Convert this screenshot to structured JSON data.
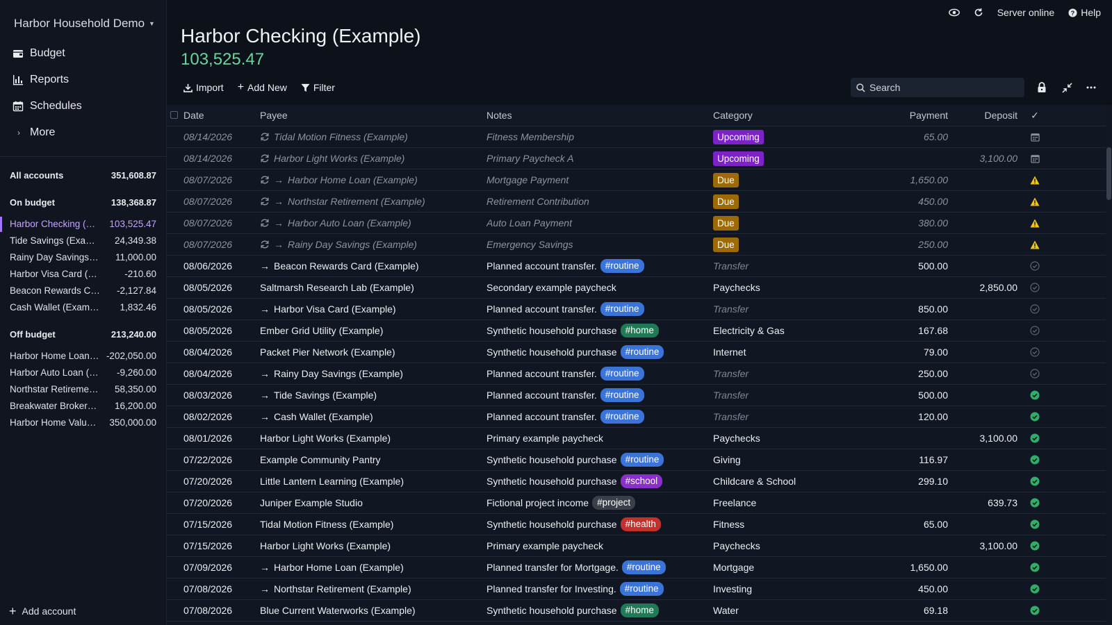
{
  "sidebar": {
    "budget_name": "Harbor Household Demo",
    "nav": {
      "budget": "Budget",
      "reports": "Reports",
      "schedules": "Schedules",
      "more": "More"
    },
    "all_accounts": {
      "label": "All accounts",
      "balance": "351,608.87"
    },
    "on_budget": {
      "label": "On budget",
      "balance": "138,368.87"
    },
    "on_budget_accounts": [
      {
        "name": "Harbor Checking (Example)",
        "balance": "103,525.47"
      },
      {
        "name": "Tide Savings (Example)",
        "balance": "24,349.38"
      },
      {
        "name": "Rainy Day Savings (Example)",
        "balance": "11,000.00"
      },
      {
        "name": "Harbor Visa Card (Example)",
        "balance": "-210.60"
      },
      {
        "name": "Beacon Rewards Card (Example)",
        "balance": "-2,127.84"
      },
      {
        "name": "Cash Wallet (Example)",
        "balance": "1,832.46"
      }
    ],
    "off_budget": {
      "label": "Off budget",
      "balance": "213,240.00"
    },
    "off_budget_accounts": [
      {
        "name": "Harbor Home Loan (Example)",
        "balance": "-202,050.00"
      },
      {
        "name": "Harbor Auto Loan (Example)",
        "balance": "-9,260.00"
      },
      {
        "name": "Northstar Retirement (Example)",
        "balance": "58,350.00"
      },
      {
        "name": "Breakwater Brokerage (Example)",
        "balance": "16,200.00"
      },
      {
        "name": "Harbor Home Value (Example)",
        "balance": "350,000.00"
      }
    ],
    "add_account": "Add account"
  },
  "topbar": {
    "server_status": "Server online",
    "help": "Help"
  },
  "account": {
    "title": "Harbor Checking (Example)",
    "balance": "103,525.47"
  },
  "toolbar": {
    "import": "Import",
    "add_new": "Add New",
    "filter": "Filter",
    "search_placeholder": "Search"
  },
  "table": {
    "headers": {
      "date": "Date",
      "payee": "Payee",
      "notes": "Notes",
      "category": "Category",
      "payment": "Payment",
      "deposit": "Deposit",
      "cleared": "✓"
    },
    "rows": [
      {
        "date": "08/14/2026",
        "payee": "Tidal Motion Fitness (Example)",
        "recurring": true,
        "transfer": false,
        "notes": "Fitness Membership",
        "tag": "",
        "category": "Upcoming",
        "cat_type": "upcoming",
        "payment": "65.00",
        "deposit": "",
        "status": "calendar",
        "scheduled": true
      },
      {
        "date": "08/14/2026",
        "payee": "Harbor Light Works (Example)",
        "recurring": true,
        "transfer": false,
        "notes": "Primary Paycheck A",
        "tag": "",
        "category": "Upcoming",
        "cat_type": "upcoming",
        "payment": "",
        "deposit": "3,100.00",
        "status": "calendar",
        "scheduled": true
      },
      {
        "date": "08/07/2026",
        "payee": "Harbor Home Loan (Example)",
        "recurring": true,
        "transfer": true,
        "notes": "Mortgage Payment",
        "tag": "",
        "category": "Due",
        "cat_type": "due",
        "payment": "1,650.00",
        "deposit": "",
        "status": "warning",
        "scheduled": true
      },
      {
        "date": "08/07/2026",
        "payee": "Northstar Retirement (Example)",
        "recurring": true,
        "transfer": true,
        "notes": "Retirement Contribution",
        "tag": "",
        "category": "Due",
        "cat_type": "due",
        "payment": "450.00",
        "deposit": "",
        "status": "warning",
        "scheduled": true
      },
      {
        "date": "08/07/2026",
        "payee": "Harbor Auto Loan (Example)",
        "recurring": true,
        "transfer": true,
        "notes": "Auto Loan Payment",
        "tag": "",
        "category": "Due",
        "cat_type": "due",
        "payment": "380.00",
        "deposit": "",
        "status": "warning",
        "scheduled": true
      },
      {
        "date": "08/07/2026",
        "payee": "Rainy Day Savings (Example)",
        "recurring": true,
        "transfer": true,
        "notes": "Emergency Savings",
        "tag": "",
        "category": "Due",
        "cat_type": "due",
        "payment": "250.00",
        "deposit": "",
        "status": "warning",
        "scheduled": true
      },
      {
        "date": "08/06/2026",
        "payee": "Beacon Rewards Card (Example)",
        "recurring": false,
        "transfer": true,
        "notes": "Planned account transfer.",
        "tag": "#routine",
        "category": "Transfer",
        "cat_type": "transfer",
        "payment": "500.00",
        "deposit": "",
        "status": "uncleared",
        "scheduled": false
      },
      {
        "date": "08/05/2026",
        "payee": "Saltmarsh Research Lab (Example)",
        "recurring": false,
        "transfer": false,
        "notes": "Secondary example paycheck",
        "tag": "",
        "category": "Paychecks",
        "cat_type": "normal",
        "payment": "",
        "deposit": "2,850.00",
        "status": "uncleared",
        "scheduled": false
      },
      {
        "date": "08/05/2026",
        "payee": "Harbor Visa Card (Example)",
        "recurring": false,
        "transfer": true,
        "notes": "Planned account transfer.",
        "tag": "#routine",
        "category": "Transfer",
        "cat_type": "transfer",
        "payment": "850.00",
        "deposit": "",
        "status": "uncleared",
        "scheduled": false
      },
      {
        "date": "08/05/2026",
        "payee": "Ember Grid Utility (Example)",
        "recurring": false,
        "transfer": false,
        "notes": "Synthetic household purchase",
        "tag": "#home",
        "category": "Electricity & Gas",
        "cat_type": "normal",
        "payment": "167.68",
        "deposit": "",
        "status": "uncleared",
        "scheduled": false
      },
      {
        "date": "08/04/2026",
        "payee": "Packet Pier Network (Example)",
        "recurring": false,
        "transfer": false,
        "notes": "Synthetic household purchase",
        "tag": "#routine",
        "category": "Internet",
        "cat_type": "normal",
        "payment": "79.00",
        "deposit": "",
        "status": "uncleared",
        "scheduled": false
      },
      {
        "date": "08/04/2026",
        "payee": "Rainy Day Savings (Example)",
        "recurring": false,
        "transfer": true,
        "notes": "Planned account transfer.",
        "tag": "#routine",
        "category": "Transfer",
        "cat_type": "transfer",
        "payment": "250.00",
        "deposit": "",
        "status": "uncleared",
        "scheduled": false
      },
      {
        "date": "08/03/2026",
        "payee": "Tide Savings (Example)",
        "recurring": false,
        "transfer": true,
        "notes": "Planned account transfer.",
        "tag": "#routine",
        "category": "Transfer",
        "cat_type": "transfer",
        "payment": "500.00",
        "deposit": "",
        "status": "cleared",
        "scheduled": false
      },
      {
        "date": "08/02/2026",
        "payee": "Cash Wallet (Example)",
        "recurring": false,
        "transfer": true,
        "notes": "Planned account transfer.",
        "tag": "#routine",
        "category": "Transfer",
        "cat_type": "transfer",
        "payment": "120.00",
        "deposit": "",
        "status": "cleared",
        "scheduled": false
      },
      {
        "date": "08/01/2026",
        "payee": "Harbor Light Works (Example)",
        "recurring": false,
        "transfer": false,
        "notes": "Primary example paycheck",
        "tag": "",
        "category": "Paychecks",
        "cat_type": "normal",
        "payment": "",
        "deposit": "3,100.00",
        "status": "cleared",
        "scheduled": false
      },
      {
        "date": "07/22/2026",
        "payee": "Example Community Pantry",
        "recurring": false,
        "transfer": false,
        "notes": "Synthetic household purchase",
        "tag": "#routine",
        "category": "Giving",
        "cat_type": "normal",
        "payment": "116.97",
        "deposit": "",
        "status": "cleared",
        "scheduled": false
      },
      {
        "date": "07/20/2026",
        "payee": "Little Lantern Learning (Example)",
        "recurring": false,
        "transfer": false,
        "notes": "Synthetic household purchase",
        "tag": "#school",
        "category": "Childcare & School",
        "cat_type": "normal",
        "payment": "299.10",
        "deposit": "",
        "status": "cleared",
        "scheduled": false
      },
      {
        "date": "07/20/2026",
        "payee": "Juniper Example Studio",
        "recurring": false,
        "transfer": false,
        "notes": "Fictional project income",
        "tag": "#project",
        "category": "Freelance",
        "cat_type": "normal",
        "payment": "",
        "deposit": "639.73",
        "status": "cleared",
        "scheduled": false
      },
      {
        "date": "07/15/2026",
        "payee": "Tidal Motion Fitness (Example)",
        "recurring": false,
        "transfer": false,
        "notes": "Synthetic household purchase",
        "tag": "#health",
        "category": "Fitness",
        "cat_type": "normal",
        "payment": "65.00",
        "deposit": "",
        "status": "cleared",
        "scheduled": false
      },
      {
        "date": "07/15/2026",
        "payee": "Harbor Light Works (Example)",
        "recurring": false,
        "transfer": false,
        "notes": "Primary example paycheck",
        "tag": "",
        "category": "Paychecks",
        "cat_type": "normal",
        "payment": "",
        "deposit": "3,100.00",
        "status": "cleared",
        "scheduled": false
      },
      {
        "date": "07/09/2026",
        "payee": "Harbor Home Loan (Example)",
        "recurring": false,
        "transfer": true,
        "notes": "Planned transfer for Mortgage.",
        "tag": "#routine",
        "category": "Mortgage",
        "cat_type": "normal",
        "payment": "1,650.00",
        "deposit": "",
        "status": "cleared",
        "scheduled": false
      },
      {
        "date": "07/08/2026",
        "payee": "Northstar Retirement (Example)",
        "recurring": false,
        "transfer": true,
        "notes": "Planned transfer for Investing.",
        "tag": "#routine",
        "category": "Investing",
        "cat_type": "normal",
        "payment": "450.00",
        "deposit": "",
        "status": "cleared",
        "scheduled": false
      },
      {
        "date": "07/08/2026",
        "payee": "Blue Current Waterworks (Example)",
        "recurring": false,
        "transfer": false,
        "notes": "Synthetic household purchase",
        "tag": "#home",
        "category": "Water",
        "cat_type": "normal",
        "payment": "69.18",
        "deposit": "",
        "status": "cleared",
        "scheduled": false
      }
    ]
  },
  "colors": {
    "accent": "#a774ff",
    "balance_green": "#6cd49a",
    "upcoming": "#7c22c7",
    "due": "#9c6a06",
    "cleared": "#2fae6a",
    "warning": "#f0c419"
  }
}
